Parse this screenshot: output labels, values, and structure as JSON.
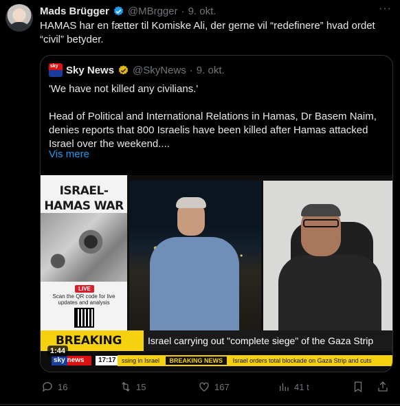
{
  "author": {
    "name": "Mads Brügger",
    "handle": "@MBrgger",
    "separator": "·",
    "date": "9. okt."
  },
  "tweet": {
    "text": "HAMAS har en fætter til Komiske Ali, der gerne vil “redefinere” hvad ordet “civil” betyder."
  },
  "quote": {
    "name": "Sky News",
    "handle": "@SkyNews",
    "separator": "·",
    "date": "9. okt.",
    "paragraph1": "'We have not killed any civilians.'",
    "paragraph2": "Head of Political and International Relations in Hamas, Dr Basem Naim, denies reports that 800 Israelis have been killed after Hamas attacked Israel over the weekend....",
    "show_more": "Vis mere"
  },
  "video": {
    "side_title": "ISRAEL-HAMAS WAR",
    "live_label": "LIVE",
    "qr_text": "Scan the QR code for live updates and analysis",
    "breaking_label": "BREAKING NEWS",
    "headline": "Israel carrying out \"complete siege\" of the Gaza Strip",
    "logo_text": "sky news",
    "clock": "17:17",
    "ticker_left": "ssing in Israel",
    "ticker_badge": "BREAKING NEWS",
    "ticker_right": "Israel orders total blockade on Gaza Strip and cuts",
    "timer": "1:44"
  },
  "actions": {
    "replies": "16",
    "reposts": "15",
    "likes": "167",
    "views": "41 t"
  },
  "colors": {
    "background": "#000000",
    "text": "#e7e9ea",
    "muted": "#71767b",
    "link": "#1d9bf0",
    "verified_blue": "#1d9bf0",
    "verified_gold": "#e2b719",
    "breaking_yellow": "#f5d10f"
  },
  "icons": [
    "more-icon",
    "verified-badge-icon",
    "reply-icon",
    "repost-icon",
    "like-icon",
    "views-icon",
    "bookmark-icon",
    "share-icon"
  ]
}
